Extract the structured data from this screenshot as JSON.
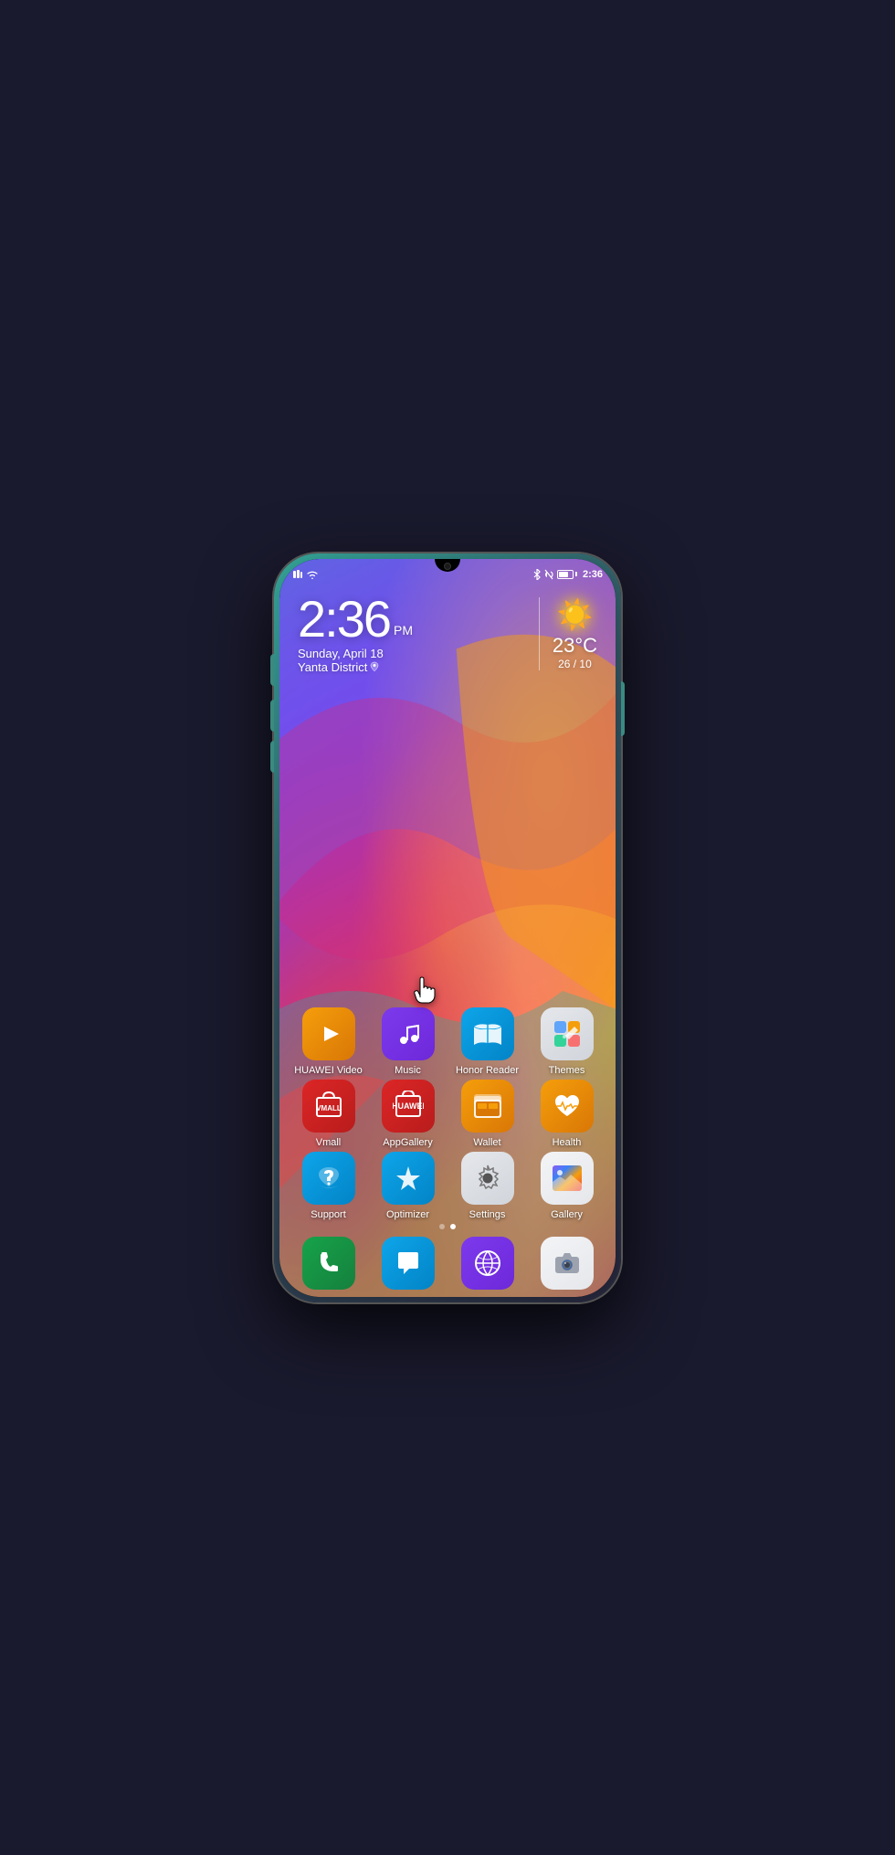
{
  "phone": {
    "status_bar": {
      "left_icons": [
        "sim-icon",
        "wifi-icon"
      ],
      "right_icons": [
        "bluetooth-icon",
        "notification-icon",
        "battery-icon"
      ],
      "time": "2:36"
    },
    "clock": {
      "time": "2:36",
      "ampm": "PM",
      "date": "Sunday, April 18",
      "location": "Yanta District"
    },
    "weather": {
      "temperature": "23°C",
      "range": "26 / 10"
    },
    "apps_row1": [
      {
        "id": "huawei-video",
        "label": "HUAWEI Video",
        "icon_class": "icon-huawei-video"
      },
      {
        "id": "music",
        "label": "Music",
        "icon_class": "icon-music"
      },
      {
        "id": "honor-reader",
        "label": "Honor Reader",
        "icon_class": "icon-honor-reader"
      },
      {
        "id": "themes",
        "label": "Themes",
        "icon_class": "icon-themes"
      }
    ],
    "apps_row2": [
      {
        "id": "vmall",
        "label": "Vmall",
        "icon_class": "icon-vmall"
      },
      {
        "id": "appgallery",
        "label": "AppGallery",
        "icon_class": "icon-appgallery"
      },
      {
        "id": "wallet",
        "label": "Wallet",
        "icon_class": "icon-wallet"
      },
      {
        "id": "health",
        "label": "Health",
        "icon_class": "icon-health"
      }
    ],
    "apps_row3": [
      {
        "id": "support",
        "label": "Support",
        "icon_class": "icon-support"
      },
      {
        "id": "optimizer",
        "label": "Optimizer",
        "icon_class": "icon-optimizer"
      },
      {
        "id": "settings",
        "label": "Settings",
        "icon_class": "icon-settings"
      },
      {
        "id": "gallery",
        "label": "Gallery",
        "icon_class": "icon-gallery"
      }
    ],
    "dock": [
      {
        "id": "phone",
        "icon_class": "icon-phone"
      },
      {
        "id": "messages",
        "icon_class": "icon-messages"
      },
      {
        "id": "browser",
        "icon_class": "icon-browser"
      },
      {
        "id": "camera",
        "icon_class": "icon-camera"
      }
    ]
  }
}
